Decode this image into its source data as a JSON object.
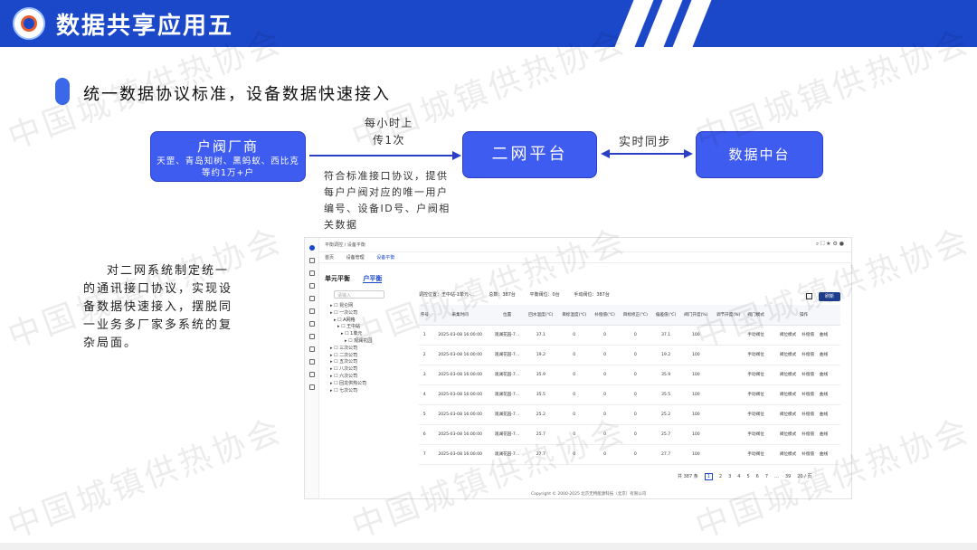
{
  "header": {
    "title": "数据共享应用五"
  },
  "subtitle": "统一数据协议标准，设备数据快速接入",
  "diagram": {
    "vendor_box": {
      "title": "户阀厂商",
      "desc": "天罡、青岛知树、黑蚂蚁、西比克等约1万+户"
    },
    "upload_label": "每小时上传1次",
    "protocol_note": "符合标准接口协议，提供每户户阀对应的唯一用户编号、设备ID号、户阀相关数据",
    "platform_box": "二网平台",
    "sync_label": "实时同步",
    "datacenter_box": "数据中台"
  },
  "paragraph": "对二网系统制定统一的通讯接口协议，实现设备数据快速接入，摆脱同一业务多厂家多系统的复杂局面。",
  "watermark": "中国城镇供热协会",
  "app": {
    "breadcrumb": [
      "平衡调控",
      "设备平衡"
    ],
    "tabs": [
      "首页",
      "设备管理",
      "设备平衡"
    ],
    "subtabs": [
      "单元平衡",
      "户平衡"
    ],
    "search_placeholder": "请输入",
    "tree": [
      "昆仑网",
      "一次公司",
      "A网格",
      "王中站",
      "1单元",
      "观澜花园",
      "三次公司",
      "二次公司",
      "五次公司",
      "八次公司",
      "六次公司",
      "回龙供热公司",
      "七次公司"
    ],
    "stats": [
      "调控位置：王中站-1单元-…",
      "总数：387台",
      "平衡阀位：0台",
      "手动阀位：387台"
    ],
    "refresh_label": "刷新",
    "columns": [
      "序号",
      "采集时间",
      "位置",
      "回水温度(℃)",
      "目标温度(℃)",
      "补偿值(℃)",
      "目标修正(℃)",
      "偏差值(℃)",
      "阀门开度(%)",
      "调节开度(%)",
      "阀门模式",
      "操作"
    ],
    "rows": [
      [
        "1",
        "2025-03-08 16:00:00",
        "观澜花园-7…",
        "37.1",
        "0",
        "0",
        "0",
        "37.1",
        "100",
        "",
        "手动阀位"
      ],
      [
        "2",
        "2025-03-08 16:00:00",
        "观澜花园-7…",
        "19.2",
        "0",
        "0",
        "0",
        "19.2",
        "100",
        "",
        "手动阀位"
      ],
      [
        "3",
        "2025-03-08 16:00:00",
        "观澜花园-7…",
        "35.9",
        "0",
        "0",
        "0",
        "35.9",
        "100",
        "",
        "手动阀位"
      ],
      [
        "4",
        "2025-03-08 16:00:00",
        "观澜花园-7…",
        "35.5",
        "0",
        "0",
        "0",
        "35.5",
        "100",
        "",
        "手动阀位"
      ],
      [
        "5",
        "2025-03-08 16:00:00",
        "观澜花园-7…",
        "25.2",
        "0",
        "0",
        "0",
        "25.2",
        "100",
        "",
        "手动阀位"
      ],
      [
        "6",
        "2025-03-08 16:00:00",
        "观澜花园-7…",
        "25.7",
        "0",
        "0",
        "0",
        "25.7",
        "100",
        "",
        "手动阀位"
      ],
      [
        "7",
        "2025-03-08 16:00:00",
        "观澜花园-7…",
        "27.7",
        "0",
        "0",
        "0",
        "27.7",
        "100",
        "",
        "手动阀位"
      ]
    ],
    "op_labels": [
      "阀位模式",
      "补偿值",
      "曲线"
    ],
    "pager": {
      "total": "共 387 条",
      "pages": [
        "1",
        "2",
        "3",
        "4",
        "5",
        "6",
        "7",
        "...",
        "39"
      ],
      "size": "20 / 页"
    },
    "copyright": "Copyright © 2000-2025 北京无特能源科技（北京）有限公司"
  },
  "colors": {
    "brand": "#1b47c9",
    "box": "#3f5cf0"
  }
}
